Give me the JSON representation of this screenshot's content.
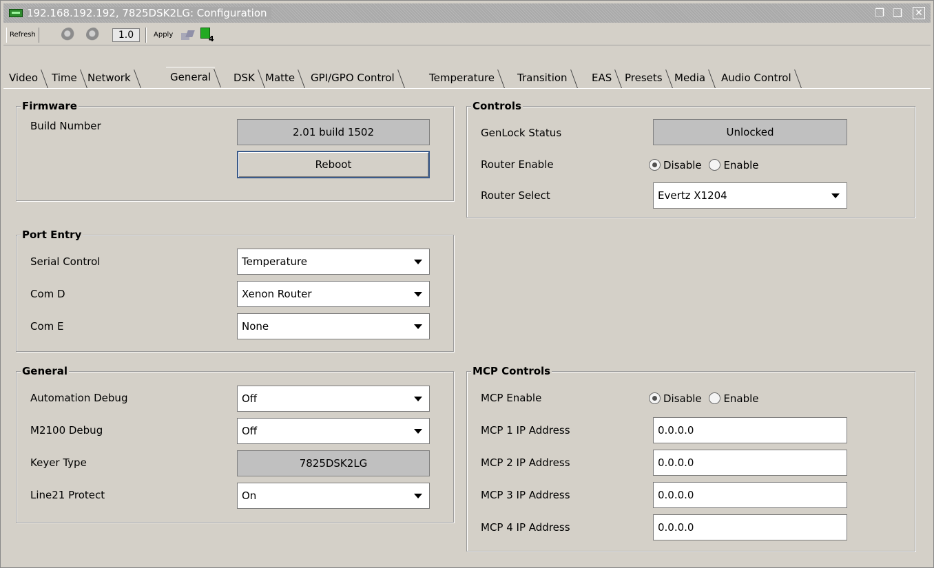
{
  "window": {
    "title": "192.168.192.192, 7825DSK2LG: Configuration",
    "icon": "card-icon",
    "controls": [
      "restore-icon",
      "maximize-icon",
      "close-icon"
    ]
  },
  "toolbar": {
    "refresh_label": "Refresh",
    "zoom_value": "1.0",
    "apply_label": "Apply"
  },
  "tabs": [
    {
      "label": "Video"
    },
    {
      "label": "Time"
    },
    {
      "label": "Network"
    },
    {
      "label": "General",
      "active": true
    },
    {
      "label": "DSK"
    },
    {
      "label": "Matte"
    },
    {
      "label": "GPI/GPO Control"
    },
    {
      "label": "Temperature"
    },
    {
      "label": "Transition"
    },
    {
      "label": "EAS"
    },
    {
      "label": "Presets"
    },
    {
      "label": "Media"
    },
    {
      "label": "Audio Control"
    }
  ],
  "firmware": {
    "title": "Firmware",
    "build_number_label": "Build Number",
    "build_number_value": "2.01 build 1502",
    "reboot_label": "Reboot"
  },
  "port_entry": {
    "title": "Port Entry",
    "serial_control_label": "Serial Control",
    "serial_control_value": "Temperature",
    "com_d_label": "Com D",
    "com_d_value": "Xenon Router",
    "com_e_label": "Com E",
    "com_e_value": "None"
  },
  "general": {
    "title": "General",
    "automation_debug_label": "Automation Debug",
    "automation_debug_value": "Off",
    "m2100_debug_label": "M2100 Debug",
    "m2100_debug_value": "Off",
    "keyer_type_label": "Keyer Type",
    "keyer_type_value": "7825DSK2LG",
    "line21_protect_label": "Line21 Protect",
    "line21_protect_value": "On"
  },
  "controls": {
    "title": "Controls",
    "genlock_label": "GenLock Status",
    "genlock_value": "Unlocked",
    "router_enable_label": "Router Enable",
    "router_enable_options": [
      "Disable",
      "Enable"
    ],
    "router_enable_selected": "Disable",
    "router_select_label": "Router Select",
    "router_select_value": "Evertz X1204"
  },
  "mcp": {
    "title": "MCP Controls",
    "enable_label": "MCP Enable",
    "enable_options": [
      "Disable",
      "Enable"
    ],
    "enable_selected": "Disable",
    "ip1_label": "MCP 1 IP Address",
    "ip1_value": "0.0.0.0",
    "ip2_label": "MCP 2 IP Address",
    "ip2_value": "0.0.0.0",
    "ip3_label": "MCP 3 IP Address",
    "ip3_value": "0.0.0.0",
    "ip4_label": "MCP 4 IP Address",
    "ip4_value": "0.0.0.0"
  }
}
